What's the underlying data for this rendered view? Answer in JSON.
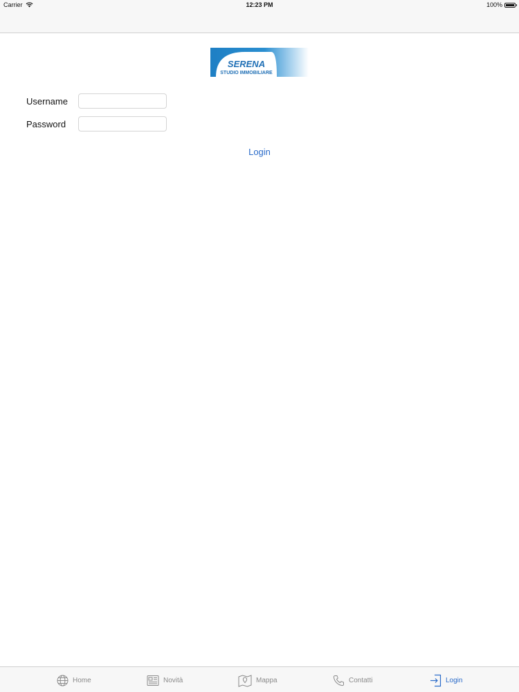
{
  "status_bar": {
    "carrier": "Carrier",
    "time": "12:23 PM",
    "battery": "100%"
  },
  "logo": {
    "line1": "SERENA",
    "line2": "STUDIO IMMOBILIARE"
  },
  "form": {
    "username_label": "Username",
    "username_value": "",
    "password_label": "Password",
    "password_value": "",
    "login_label": "Login"
  },
  "tabs": [
    {
      "label": "Home",
      "icon": "globe-icon"
    },
    {
      "label": "Novità",
      "icon": "newspaper-icon"
    },
    {
      "label": "Mappa",
      "icon": "map-icon"
    },
    {
      "label": "Contatti",
      "icon": "phone-icon"
    },
    {
      "label": "Login",
      "icon": "login-icon",
      "active": true
    }
  ],
  "colors": {
    "accent": "#2a6bc9",
    "inactive_tab": "#8a8a8a",
    "bar_background": "#f7f7f7",
    "logo_blue": "#1e7fc4"
  }
}
